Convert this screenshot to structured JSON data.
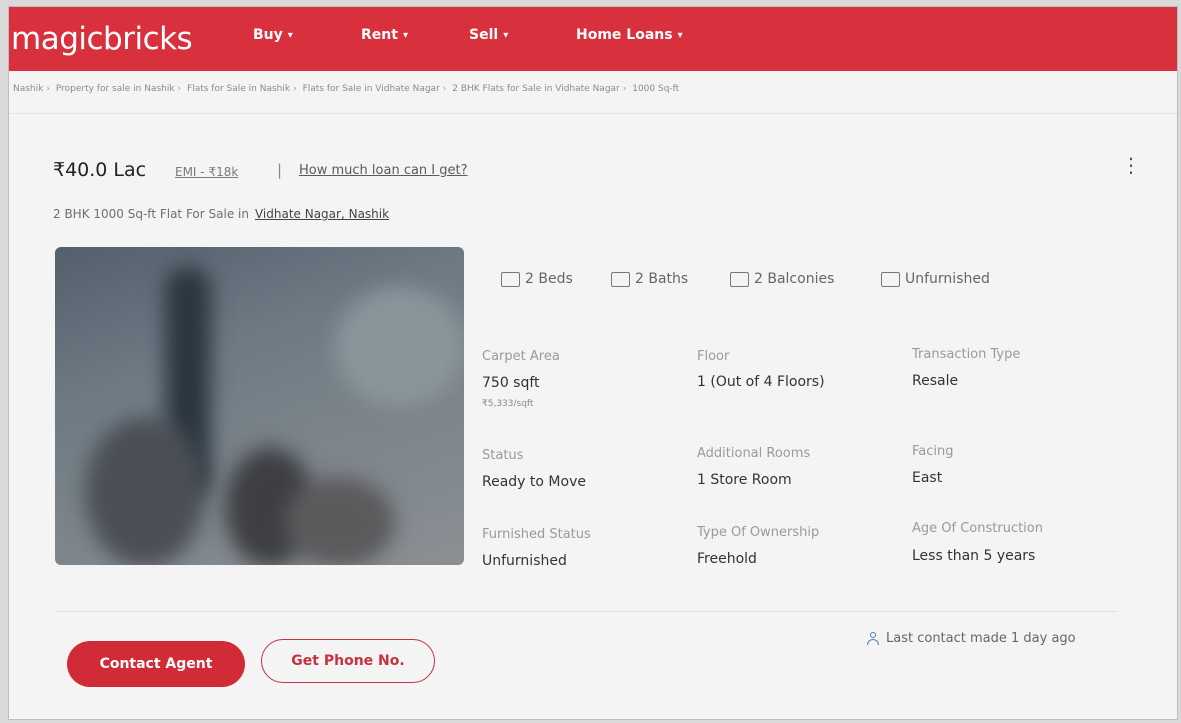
{
  "header": {
    "logo": "magicbricks",
    "nav": [
      {
        "label": "Buy",
        "icon": "chevron-down-icon"
      },
      {
        "label": "Rent",
        "icon": "chevron-down-icon"
      },
      {
        "label": "Sell",
        "icon": "chevron-down-icon"
      },
      {
        "label": "Home Loans",
        "icon": "chevron-down-icon"
      }
    ],
    "brand_color": "#d8303c"
  },
  "breadcrumb": [
    "Nashik",
    "Property for sale in Nashik",
    "Flats for Sale in Nashik",
    "Flats for Sale in Vidhate Nagar",
    "2 BHK Flats for Sale in Vidhate Nagar",
    "1000 Sq-ft"
  ],
  "listing": {
    "price": "₹40.0 Lac",
    "emi": "EMI - ₹18k",
    "separator": "|",
    "loan_link": "How much loan can I get?",
    "subtitle_prefix": "2 BHK 1000 Sq-ft Flat For Sale in",
    "location": "Vidhate Nagar, Nashik",
    "features": [
      {
        "label": "2 Beds",
        "icon": "bed-icon"
      },
      {
        "label": "2 Baths",
        "icon": "bath-icon"
      },
      {
        "label": "2 Balconies",
        "icon": "balcony-icon"
      },
      {
        "label": "Unfurnished",
        "icon": "furnishing-icon"
      }
    ],
    "details": {
      "carpet_area": {
        "label": "Carpet Area",
        "value": "750 sqft",
        "sub": "₹5,333/sqft"
      },
      "floor": {
        "label": "Floor",
        "value": "1 (Out of 4 Floors)"
      },
      "transaction_type": {
        "label": "Transaction Type",
        "value": "Resale"
      },
      "status": {
        "label": "Status",
        "value": "Ready to Move"
      },
      "additional_rooms": {
        "label": "Additional Rooms",
        "value": "1 Store Room"
      },
      "facing": {
        "label": "Facing",
        "value": "East"
      },
      "furnished_status": {
        "label": "Furnished Status",
        "value": "Unfurnished"
      },
      "ownership": {
        "label": "Type Of Ownership",
        "value": "Freehold"
      },
      "age": {
        "label": "Age Of Construction",
        "value": "Less than 5 years"
      }
    },
    "last_contact": "Last contact made 1 day ago"
  },
  "actions": {
    "contact_agent": "Contact Agent",
    "get_phone": "Get Phone No."
  }
}
